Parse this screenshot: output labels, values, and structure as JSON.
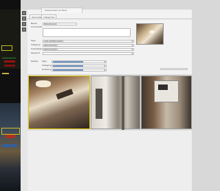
{
  "window": {
    "title": "Shared Items to Work",
    "tabs": [
      "Generalsetts",
      "Categories"
    ]
  },
  "form": {
    "name": {
      "label": "Name",
      "value": "BRIDGELOCKS"
    },
    "comments": {
      "label": "Comments",
      "value": ""
    },
    "type": {
      "label": "Type",
      "value": "ARSLASHBNDL/PANEL"
    },
    "category": {
      "label": "Category",
      "value": "BRIDGEWORKS"
    },
    "subcategory": {
      "label": "Subcategory",
      "value": "BRIDGEWORKS"
    },
    "keyword": {
      "label": "Keyword",
      "value": ""
    }
  },
  "filters": {
    "section_label": "Details",
    "rows": [
      {
        "label": "Type",
        "fill": 0.55
      },
      {
        "label": "Category",
        "fill": 0.55
      },
      {
        "label": "Ordering",
        "fill": 0.55
      }
    ]
  },
  "icons": {
    "chevron": "▾"
  }
}
